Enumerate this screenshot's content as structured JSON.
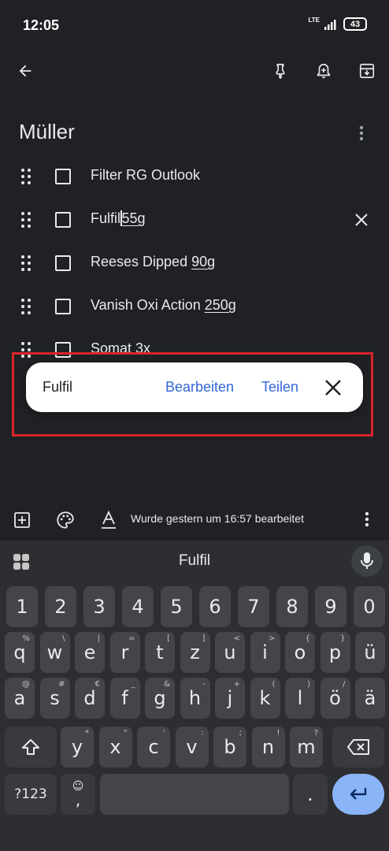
{
  "status": {
    "time": "12:05",
    "network": "LTE",
    "battery": "43"
  },
  "note": {
    "title": "Müller"
  },
  "items": [
    {
      "prefix": "Filter RG Outlook",
      "underlined": ""
    },
    {
      "prefix": "Fulfil",
      "underlined": "55g"
    },
    {
      "prefix": "Reeses Dipped ",
      "underlined": "90g"
    },
    {
      "prefix": "Vanish Oxi Action ",
      "underlined": "250g"
    },
    {
      "prefix": "Somat 3x",
      "underlined": ""
    }
  ],
  "snackbar": {
    "text": "Fulfil",
    "edit": "Bearbeiten",
    "share": "Teilen"
  },
  "toolbar": {
    "edited": "Wurde gestern um 16:57 bearbeitet"
  },
  "keyboard": {
    "suggestion": "Fulfil",
    "row_numbers": [
      "1",
      "2",
      "3",
      "4",
      "5",
      "6",
      "7",
      "8",
      "9",
      "0"
    ],
    "row1": [
      [
        "q",
        "%"
      ],
      [
        "w",
        "\\"
      ],
      [
        "e",
        "|"
      ],
      [
        "r",
        "="
      ],
      [
        "t",
        "["
      ],
      [
        "z",
        "]"
      ],
      [
        "u",
        "<"
      ],
      [
        "i",
        ">"
      ],
      [
        "o",
        "{"
      ],
      [
        "p",
        "}"
      ],
      [
        "ü",
        ""
      ]
    ],
    "row2": [
      [
        "a",
        "@"
      ],
      [
        "s",
        "#"
      ],
      [
        "d",
        "€"
      ],
      [
        "f",
        "_"
      ],
      [
        "g",
        "&"
      ],
      [
        "h",
        "-"
      ],
      [
        "j",
        "+"
      ],
      [
        "k",
        "("
      ],
      [
        "l",
        ")"
      ],
      [
        "ö",
        "/"
      ],
      [
        "ä",
        ""
      ]
    ],
    "row3": [
      [
        "y",
        "*"
      ],
      [
        "x",
        "\""
      ],
      [
        "c",
        "'"
      ],
      [
        "v",
        ":"
      ],
      [
        "b",
        ";"
      ],
      [
        "n",
        "!"
      ],
      [
        "m",
        "?"
      ]
    ],
    "sym_label": "?123",
    "comma": ",",
    "period": "."
  },
  "colors": {
    "background": "#202124",
    "accent": "#3367d6",
    "annotation": "#d8252c",
    "enter": "#8ab4f8"
  }
}
